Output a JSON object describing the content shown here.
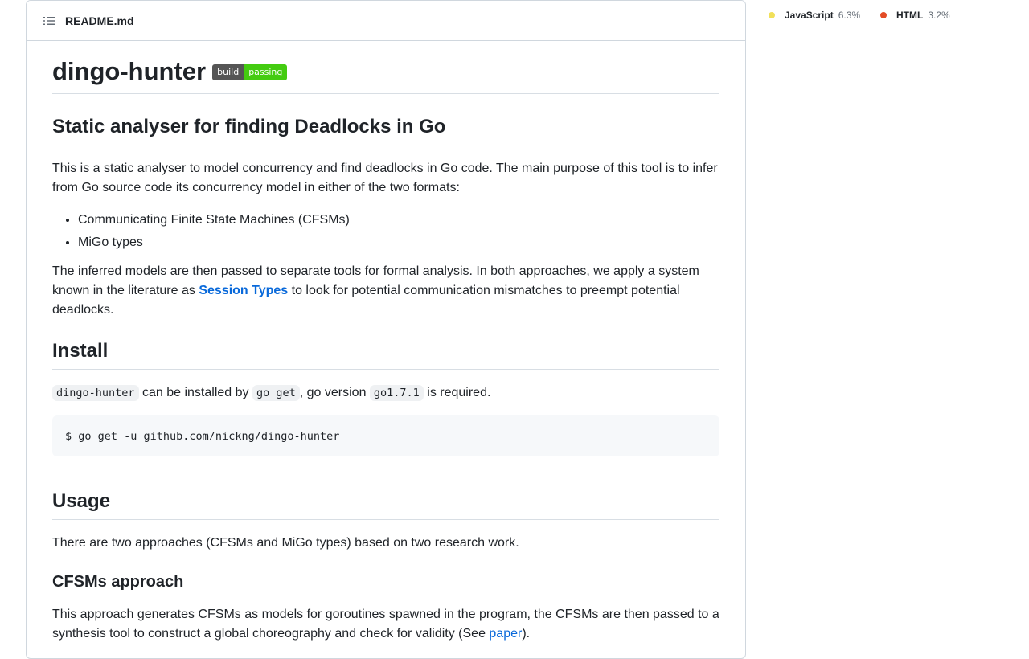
{
  "readme": {
    "filename": "README.md",
    "title": "dingo-hunter",
    "badge": {
      "left": "build",
      "right": "passing"
    },
    "subtitle": "Static analyser for finding Deadlocks in Go",
    "intro": "This is a static analyser to model concurrency and find deadlocks in Go code. The main purpose of this tool is to infer from Go source code its concurrency model in either of the two formats:",
    "formats": [
      "Communicating Finite State Machines (CFSMs)",
      "MiGo types"
    ],
    "analysis_before": "The inferred models are then passed to separate tools for formal analysis. In both approaches, we apply a system known in the literature as ",
    "analysis_link": "Session Types",
    "analysis_after": " to look for potential communication mismatches to preempt potential deadlocks.",
    "install_heading": "Install",
    "install_code1": "dingo-hunter",
    "install_text1": " can be installed by ",
    "install_code2": "go get",
    "install_text2": ", go version ",
    "install_code3": "go1.7.1",
    "install_text3": " is required.",
    "install_command": "$ go get -u github.com/nickng/dingo-hunter",
    "usage_heading": "Usage",
    "usage_text": "There are two approaches (CFSMs and MiGo types) based on two research work.",
    "cfsms_heading": "CFSMs approach",
    "cfsms_text_before": "This approach generates CFSMs as models for goroutines spawned in the program, the CFSMs are then passed to a synthesis tool to construct a global choreography and check for validity (See ",
    "cfsms_link": "paper",
    "cfsms_text_after": ")."
  },
  "languages": [
    {
      "name": "JavaScript",
      "percent": "6.3%",
      "color": "#f1e05a"
    },
    {
      "name": "HTML",
      "percent": "3.2%",
      "color": "#e34c26"
    }
  ],
  "icons": {
    "toc": "list-unordered-icon"
  }
}
